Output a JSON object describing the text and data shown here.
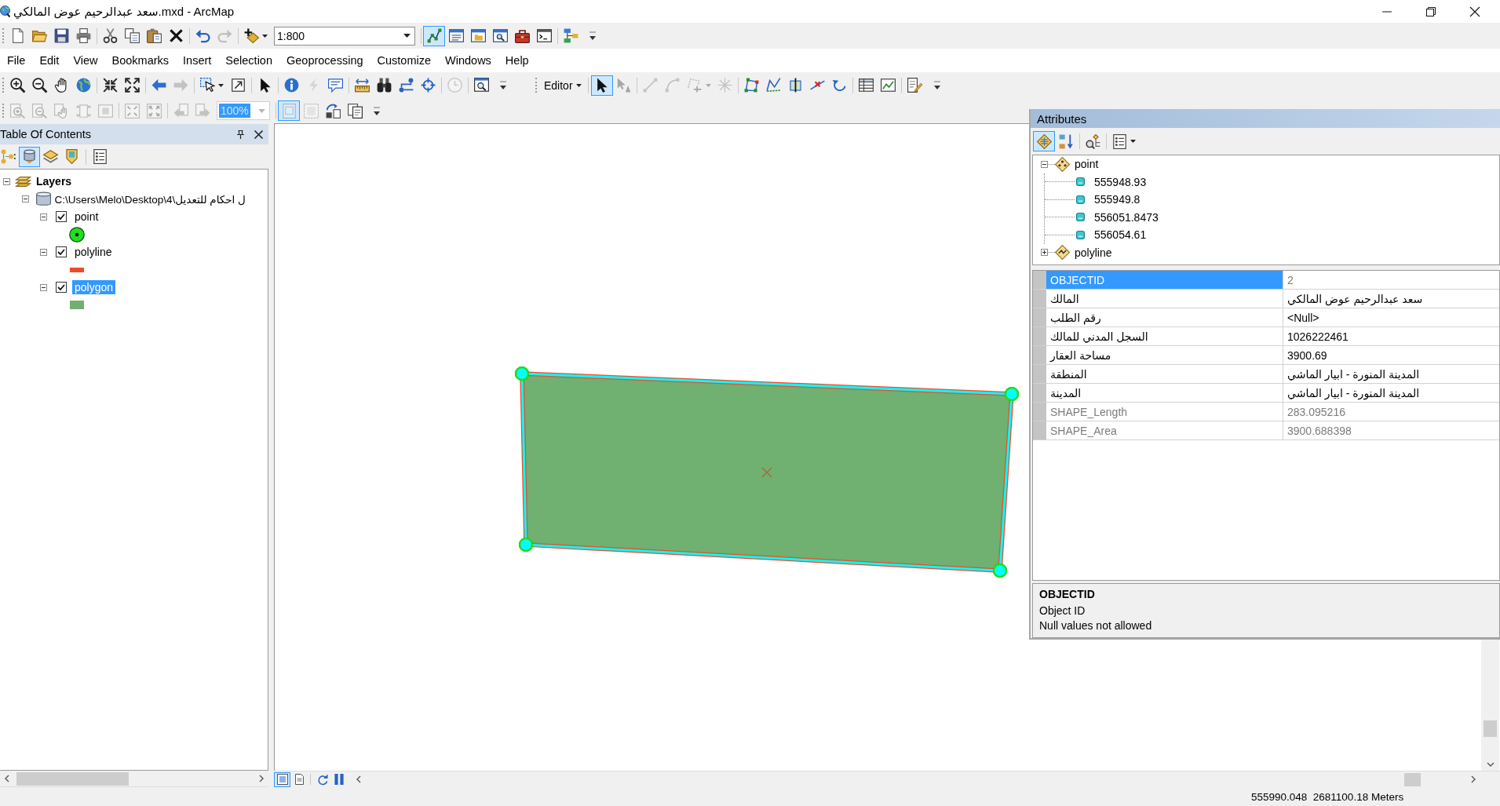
{
  "window": {
    "title": "سعد عبدالرحيم عوض المالكي.mxd - ArcMap"
  },
  "standard_toolbar": {
    "groups": [
      [
        {
          "kind": "new",
          "disabled": false,
          "pressed": false
        },
        {
          "kind": "open",
          "disabled": false,
          "pressed": false
        },
        {
          "kind": "save",
          "disabled": false,
          "pressed": false
        },
        {
          "kind": "print",
          "disabled": false,
          "pressed": false
        }
      ],
      [
        {
          "kind": "cut",
          "disabled": false,
          "pressed": false
        },
        {
          "kind": "copy",
          "disabled": false,
          "pressed": false
        },
        {
          "kind": "paste",
          "disabled": false,
          "pressed": false
        },
        {
          "kind": "delete",
          "disabled": false,
          "pressed": false
        }
      ],
      [
        {
          "kind": "undo",
          "disabled": false,
          "pressed": false
        },
        {
          "kind": "redo",
          "disabled": true,
          "pressed": false
        }
      ],
      [
        {
          "kind": "add_data",
          "disabled": false,
          "pressed": false,
          "dropdown": true
        },
        {
          "kind": "scale_combo",
          "value": "1:800",
          "disabled": false,
          "text_selected": false
        }
      ],
      [
        {
          "kind": "editor_toolbar",
          "disabled": false,
          "pressed": true
        },
        {
          "kind": "toc_window",
          "disabled": false,
          "pressed": false
        },
        {
          "kind": "catalog",
          "disabled": false,
          "pressed": false
        },
        {
          "kind": "search_window",
          "disabled": false,
          "pressed": false
        },
        {
          "kind": "toolbox",
          "disabled": false,
          "pressed": false
        },
        {
          "kind": "python",
          "disabled": false,
          "pressed": false
        }
      ],
      [
        {
          "kind": "model_builder",
          "disabled": false,
          "pressed": false
        },
        {
          "kind": "overflow",
          "disabled": false,
          "pressed": false
        }
      ]
    ]
  },
  "menu": [
    "File",
    "Edit",
    "View",
    "Bookmarks",
    "Insert",
    "Selection",
    "Geoprocessing",
    "Customize",
    "Windows",
    "Help"
  ],
  "tools_toolbar": {
    "groups": [
      [
        {
          "kind": "zoom_in",
          "disabled": false,
          "pressed": false
        },
        {
          "kind": "zoom_out",
          "disabled": false,
          "pressed": false
        },
        {
          "kind": "pan",
          "disabled": false,
          "pressed": false
        },
        {
          "kind": "full_extent",
          "disabled": false,
          "pressed": false
        }
      ],
      [
        {
          "kind": "fixed_zoom_in",
          "disabled": false,
          "pressed": false
        },
        {
          "kind": "fixed_zoom_out",
          "disabled": false,
          "pressed": false
        }
      ],
      [
        {
          "kind": "back",
          "disabled": false,
          "pressed": false
        },
        {
          "kind": "forward",
          "disabled": true,
          "pressed": false
        }
      ],
      [
        {
          "kind": "select_features",
          "disabled": false,
          "pressed": false,
          "dropdown": true
        },
        {
          "kind": "clear_selection",
          "disabled": false,
          "pressed": false
        }
      ],
      [
        {
          "kind": "select_elements",
          "disabled": false,
          "pressed": false
        }
      ],
      [
        {
          "kind": "identify",
          "disabled": false,
          "pressed": false
        },
        {
          "kind": "hyperlink",
          "disabled": true,
          "pressed": false
        },
        {
          "kind": "html_popup",
          "disabled": false,
          "pressed": false
        }
      ],
      [
        {
          "kind": "measure",
          "disabled": false,
          "pressed": false
        },
        {
          "kind": "find",
          "disabled": false,
          "pressed": false
        },
        {
          "kind": "route",
          "disabled": false,
          "pressed": false
        },
        {
          "kind": "goto_xy",
          "disabled": false,
          "pressed": false
        }
      ],
      [
        {
          "kind": "time_slider",
          "disabled": true,
          "pressed": false
        }
      ],
      [
        {
          "kind": "viewer",
          "disabled": false,
          "pressed": false
        },
        {
          "kind": "overflow",
          "disabled": false,
          "pressed": false
        }
      ]
    ]
  },
  "editor_toolbar": {
    "groups": [
      [
        {
          "kind": "menu_button",
          "label": "Editor",
          "disabled": false,
          "pressed": false
        }
      ],
      [
        {
          "kind": "edit_tool",
          "disabled": false,
          "pressed": true
        },
        {
          "kind": "annotation_tool",
          "disabled": true,
          "pressed": false
        }
      ],
      [
        {
          "kind": "straight_segment",
          "disabled": true,
          "pressed": false
        },
        {
          "kind": "endpoint_arc",
          "disabled": true,
          "pressed": false
        },
        {
          "kind": "construction",
          "disabled": true,
          "pressed": false,
          "dropdown": true
        },
        {
          "kind": "point_tool",
          "disabled": true,
          "pressed": false
        }
      ],
      [
        {
          "kind": "edit_vertices",
          "disabled": false,
          "pressed": false
        },
        {
          "kind": "reshape",
          "disabled": false,
          "pressed": false
        },
        {
          "kind": "cut_polygon",
          "disabled": false,
          "pressed": false
        },
        {
          "kind": "split",
          "disabled": false,
          "pressed": false
        },
        {
          "kind": "rotate",
          "disabled": false,
          "pressed": false
        }
      ],
      [
        {
          "kind": "attributes",
          "disabled": false,
          "pressed": false
        },
        {
          "kind": "sketch_properties",
          "disabled": false,
          "pressed": false
        }
      ],
      [
        {
          "kind": "create_features",
          "disabled": false,
          "pressed": false
        },
        {
          "kind": "overflow",
          "disabled": false,
          "pressed": false
        }
      ]
    ]
  },
  "layout_toolbar": {
    "groups": [
      [
        {
          "kind": "page_zoom_in",
          "disabled": true,
          "pressed": false
        },
        {
          "kind": "page_zoom_out",
          "disabled": true,
          "pressed": false
        },
        {
          "kind": "page_pan",
          "disabled": true,
          "pressed": false
        },
        {
          "kind": "zoom_whole_page",
          "disabled": true,
          "pressed": false
        },
        {
          "kind": "zoom_100",
          "disabled": true,
          "pressed": false
        }
      ],
      [
        {
          "kind": "fixed_page_in",
          "disabled": true,
          "pressed": false
        },
        {
          "kind": "fixed_page_out",
          "disabled": true,
          "pressed": false
        }
      ],
      [
        {
          "kind": "page_back",
          "disabled": true,
          "pressed": false
        },
        {
          "kind": "page_forward",
          "disabled": true,
          "pressed": false
        },
        {
          "kind": "zoom_combo",
          "value": "100%",
          "disabled": true,
          "text_selected": true
        }
      ],
      [
        {
          "kind": "draft_mode",
          "disabled": true,
          "pressed": true
        },
        {
          "kind": "focus_frame",
          "disabled": true,
          "pressed": false
        },
        {
          "kind": "change_layout",
          "disabled": false,
          "pressed": false
        },
        {
          "kind": "ddp",
          "disabled": false,
          "pressed": false
        },
        {
          "kind": "overflow",
          "disabled": false,
          "pressed": false
        }
      ]
    ]
  },
  "toc": {
    "title": "Table Of Contents",
    "tools": [
      [
        {
          "kind": "list_drawing_order",
          "pressed": false
        },
        {
          "kind": "list_by_source",
          "pressed": true
        },
        {
          "kind": "list_by_visibility",
          "pressed": false
        },
        {
          "kind": "list_by_selection",
          "pressed": false
        }
      ],
      [
        {
          "kind": "toc_options",
          "pressed": false
        }
      ]
    ],
    "tree": [
      {
        "label": "Layers",
        "kind": "frame",
        "expanded": true,
        "children": [
          {
            "label": "C:\\Users\\Melo\\Desktop\\4\\ل احكام للتعديل",
            "kind": "workspace",
            "expanded": true,
            "children": [
              {
                "label": "point",
                "kind": "point",
                "checked": true,
                "expanded": true,
                "selected": false,
                "color": "#1fe01f"
              },
              {
                "label": "polyline",
                "kind": "line",
                "checked": true,
                "expanded": true,
                "selected": false,
                "color": "#f04a28"
              },
              {
                "label": "polygon",
                "kind": "polygon",
                "checked": true,
                "expanded": true,
                "selected": true,
                "color": "#70b070"
              }
            ]
          }
        ]
      }
    ]
  },
  "map": {
    "features_selected": true,
    "view_controls": [
      {
        "kind": "data_view",
        "pressed": true
      },
      {
        "kind": "layout_view",
        "pressed": false
      },
      {
        "kind": "refresh",
        "pressed": false
      },
      {
        "kind": "pause",
        "pressed": false
      }
    ]
  },
  "attributes": {
    "title": "Attributes",
    "tools": [
      [
        {
          "kind": "list_by_layer",
          "pressed": true
        },
        {
          "kind": "sort",
          "pressed": false
        }
      ],
      [
        {
          "kind": "identify_related",
          "pressed": false
        }
      ],
      [
        {
          "kind": "attr_options",
          "pressed": false,
          "dropdown": true
        }
      ]
    ],
    "tree": [
      {
        "label": "point",
        "kind": "point",
        "expanded": true,
        "children": [
          {
            "label": "555948.93"
          },
          {
            "label": "555949.8"
          },
          {
            "label": "556051.8473"
          },
          {
            "label": "556054.61"
          }
        ]
      },
      {
        "label": "polyline",
        "kind": "line",
        "expanded": false
      }
    ],
    "fields": [
      {
        "name": "OBJECTID",
        "value": "2",
        "selected": true,
        "readonly": true
      },
      {
        "name": "المالك",
        "value": "سعد عبدالرحيم عوض المالكي",
        "selected": false,
        "readonly": false
      },
      {
        "name": "رقم الطلب",
        "value": "<Null>",
        "selected": false,
        "readonly": false
      },
      {
        "name": "السجل المدني للمالك",
        "value": "1026222461",
        "selected": false,
        "readonly": false
      },
      {
        "name": "مساحة العقار",
        "value": "3900.69",
        "selected": false,
        "readonly": false
      },
      {
        "name": "المنطقة",
        "value": "المدينة المنورة - ابيار الماشي",
        "selected": false,
        "readonly": false
      },
      {
        "name": "المدينة",
        "value": "المدينة المنورة - ابيار الماشي",
        "selected": false,
        "readonly": false
      },
      {
        "name": "SHAPE_Length",
        "value": "283.095216",
        "selected": false,
        "readonly": true
      },
      {
        "name": "SHAPE_Area",
        "value": "3900.688398",
        "selected": false,
        "readonly": true
      }
    ],
    "description": {
      "title": "OBJECTID",
      "lines": [
        "Object ID",
        "Null values not allowed"
      ]
    }
  },
  "status_bar": {
    "coordinates": "555990.048  2681100.18 Meters"
  }
}
